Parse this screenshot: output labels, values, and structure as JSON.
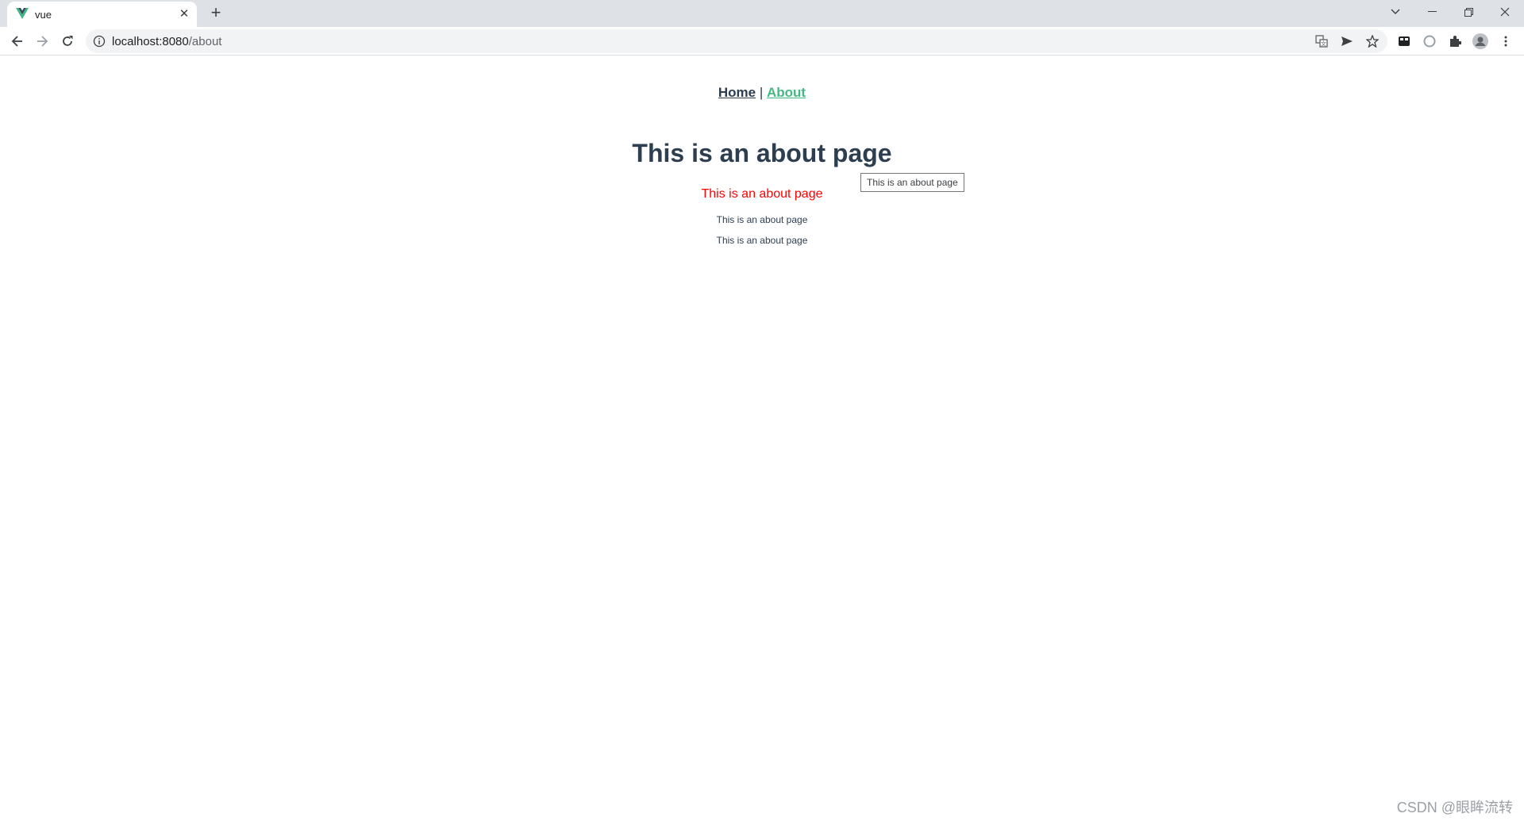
{
  "browser": {
    "tab": {
      "title": "vue",
      "close_glyph": "✕"
    },
    "new_tab_glyph": "+",
    "address": {
      "host": "localhost:8080",
      "path": "/about"
    },
    "icons": {
      "back": "arrow-left-icon",
      "forward": "arrow-right-icon",
      "reload": "reload-icon",
      "info": "info-icon",
      "translate": "translate-icon",
      "send": "send-icon",
      "bookmark": "star-icon",
      "extensions": "puzzle-icon",
      "profile": "avatar-icon",
      "menu": "kebab-menu-icon"
    },
    "window": {
      "dropdown": "⌄",
      "minimize": "–",
      "restore": "❐",
      "close": "✕"
    }
  },
  "page": {
    "nav": {
      "home": "Home",
      "separator": " | ",
      "about": "About"
    },
    "heading": "This is an about page",
    "red_line": "This is an about page",
    "lines": [
      "This is an about page",
      "This is an about page"
    ],
    "tooltip": "This is an about page"
  },
  "watermark": "CSDN @眼眸流转",
  "colors": {
    "accent": "#42b983",
    "text": "#2c3e50",
    "red": "#ff0000"
  }
}
